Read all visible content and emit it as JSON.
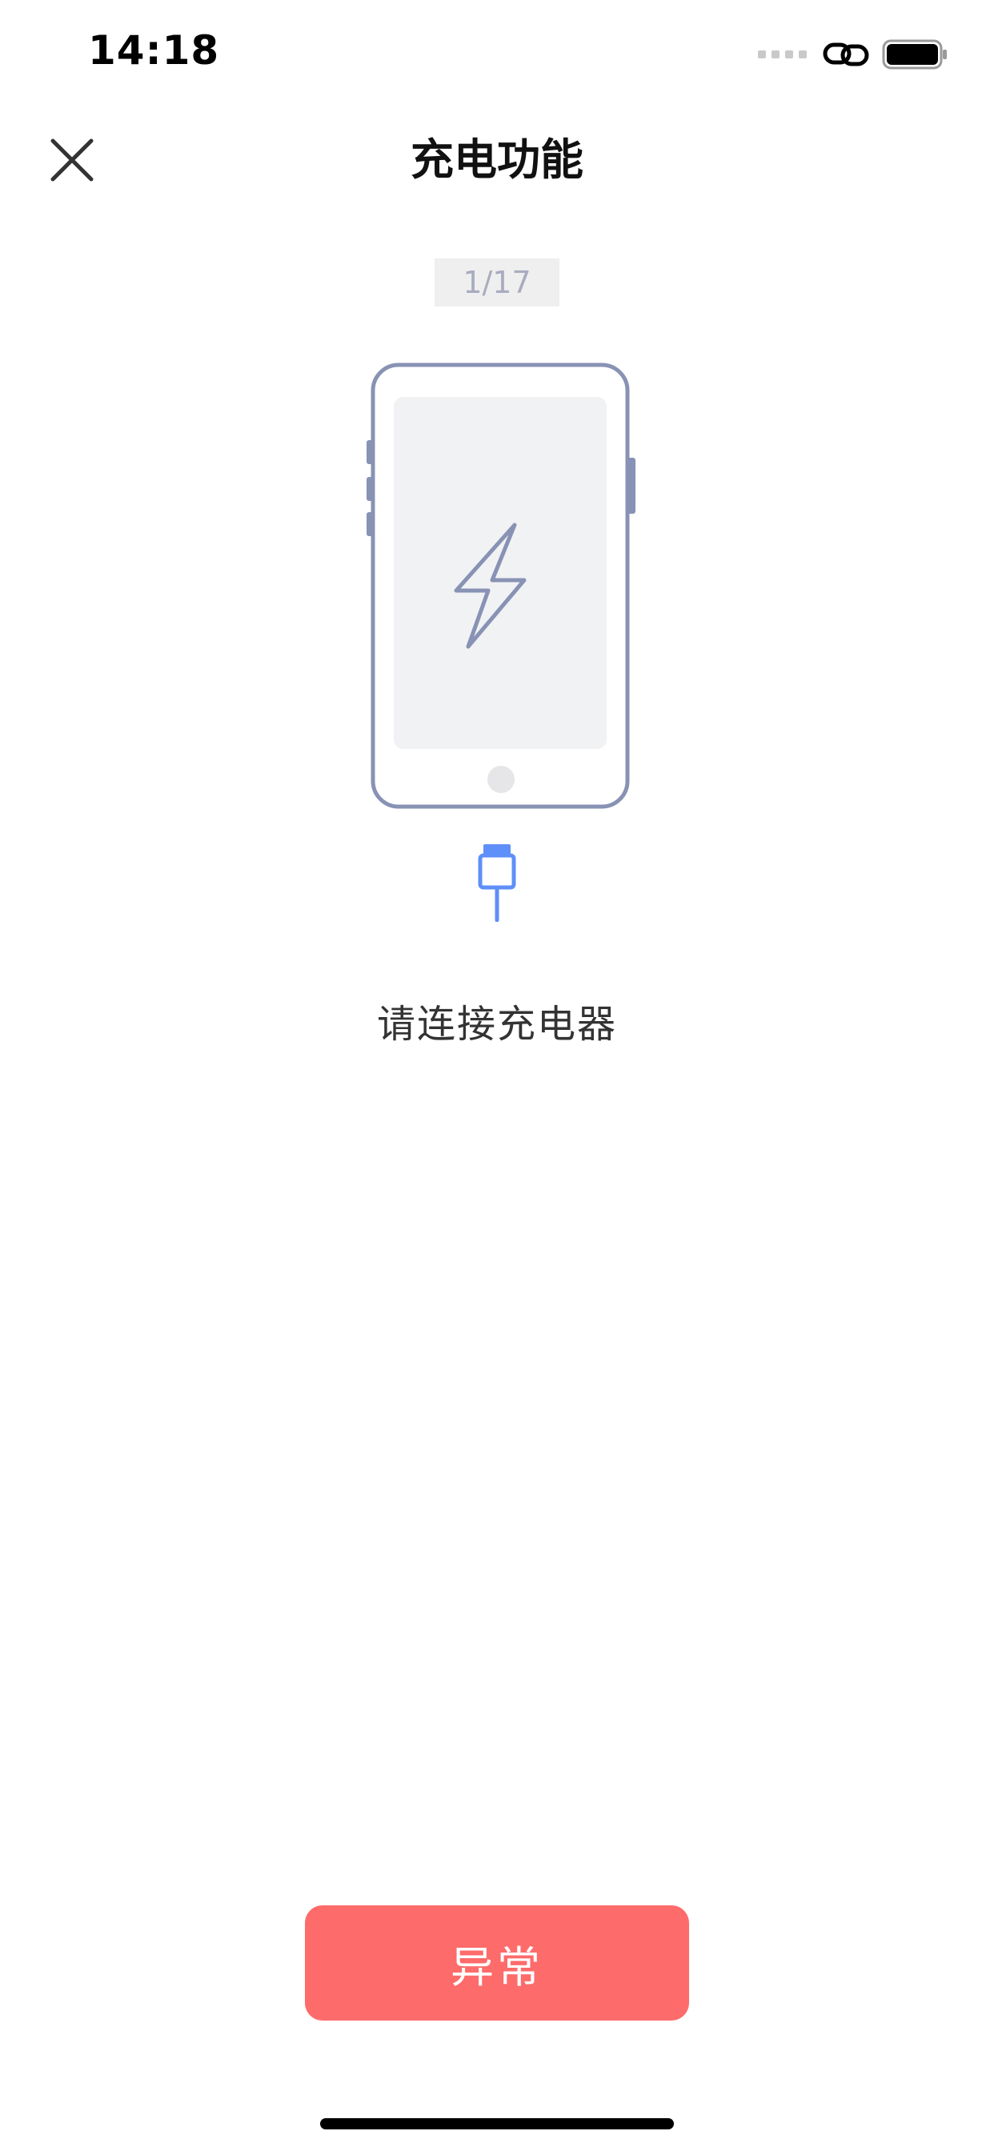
{
  "status_bar": {
    "time": "14:18",
    "icons": [
      "signal-dots-icon",
      "link-icon",
      "battery-icon"
    ]
  },
  "nav": {
    "title": "充电功能",
    "close_icon": "close-icon"
  },
  "step": {
    "counter": "1/17"
  },
  "illustration": {
    "phone_icon": "phone-charging-icon",
    "charger_icon": "charger-cable-icon"
  },
  "instruction": "请连接充电器",
  "actions": {
    "abnormal_label": "异常"
  },
  "colors": {
    "accent_red": "#fe6b6b",
    "phone_outline": "#8892b4",
    "charger_blue": "#5f8ff8",
    "counter_bg": "#efefef",
    "counter_text": "#a9acbf"
  }
}
